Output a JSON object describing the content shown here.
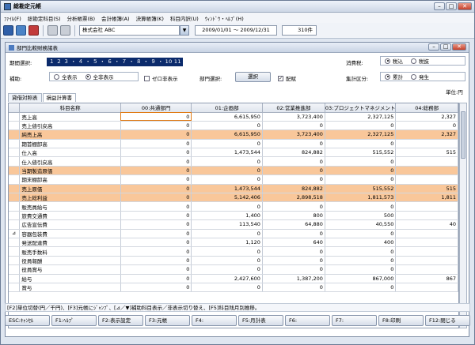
{
  "window": {
    "title": "部門比較財務諸表",
    "app_title": "総勘定元帳"
  },
  "menu": [
    "ﾌｧｲﾙ(F)",
    "総勘定科目(S)",
    "分析帳票(B)",
    "会計帳簿(A)",
    "決算帳簿(K)",
    "科目内訳(U)",
    "ｳｨﾝﾄﾞｳ・ﾍﾙﾌﾟ(H)"
  ],
  "toolbar": {
    "company": "株式会社 ABC",
    "period": "2009/01/01 〜 2009/12/31",
    "count": "310件"
  },
  "options": {
    "period_label": "期間選択:",
    "months": "１ ２ ３ ・ ４ ・ ５ ・ ６ ・ ７ ・ ８ ・ ９ ・ 10 11 12 決",
    "hojo_label": "補助:",
    "hojo_all": "全表示",
    "hojo_all_checked": "全非表示",
    "zero_hide": "ゼロ非表示",
    "dept_label": "部門選択:",
    "select_button": "選択",
    "haifu": "配賦",
    "tax_label": "消費税:",
    "tax_in": "税込",
    "tax_out": "税抜",
    "sum_label": "集計区分:",
    "sum_total": "累計",
    "sum_occur": "発生",
    "unit": "単位:円"
  },
  "tabs": [
    "貸借対照表",
    "損益計算書"
  ],
  "columns": [
    "科目名称",
    "00:共通部門",
    "01:企画部",
    "02:営業推進部",
    "03:プロジェクトマネジメント",
    "04:総務部"
  ],
  "rows": [
    {
      "mk": "",
      "name": "売上高",
      "hl": false,
      "v": [
        "0",
        "6,615,950",
        "3,723,400",
        "2,327,125",
        "2,327"
      ]
    },
    {
      "mk": "",
      "name": "売上値引戻高",
      "hl": false,
      "v": [
        "0",
        "0",
        "0",
        "0",
        "0"
      ]
    },
    {
      "mk": "",
      "name": "純売上高",
      "hl": true,
      "v": [
        "0",
        "6,615,950",
        "3,723,400",
        "2,327,125",
        "2,327"
      ]
    },
    {
      "mk": "",
      "name": "期首棚卸高",
      "hl": false,
      "v": [
        "0",
        "0",
        "0",
        "0",
        ""
      ]
    },
    {
      "mk": "",
      "name": "仕入高",
      "hl": false,
      "v": [
        "0",
        "1,473,544",
        "824,882",
        "515,552",
        "515"
      ]
    },
    {
      "mk": "",
      "name": "仕入値引戻高",
      "hl": false,
      "v": [
        "0",
        "0",
        "0",
        "0",
        ""
      ]
    },
    {
      "mk": "",
      "name": "当期製造原価",
      "hl": true,
      "v": [
        "0",
        "0",
        "0",
        "0",
        ""
      ]
    },
    {
      "mk": "",
      "name": "期末棚卸高",
      "hl": false,
      "v": [
        "0",
        "0",
        "0",
        "0",
        ""
      ]
    },
    {
      "mk": "",
      "name": "売上原価",
      "hl": true,
      "v": [
        "0",
        "1,473,544",
        "824,882",
        "515,552",
        "515"
      ]
    },
    {
      "mk": "",
      "name": "売上総利益",
      "hl": true,
      "v": [
        "0",
        "5,142,406",
        "2,898,518",
        "1,811,573",
        "1,811"
      ]
    },
    {
      "mk": "",
      "name": "販売員給与",
      "hl": false,
      "v": [
        "0",
        "0",
        "0",
        "0",
        ""
      ]
    },
    {
      "mk": "",
      "name": "旅費交通費",
      "hl": false,
      "v": [
        "0",
        "1,400",
        "800",
        "500",
        ""
      ]
    },
    {
      "mk": "",
      "name": "広告宣伝費",
      "hl": false,
      "v": [
        "0",
        "113,540",
        "64,880",
        "40,550",
        "40"
      ]
    },
    {
      "mk": "⊿",
      "name": "容器包装費",
      "hl": false,
      "v": [
        "0",
        "0",
        "0",
        "0",
        ""
      ]
    },
    {
      "mk": "",
      "name": "発送配達費",
      "hl": false,
      "v": [
        "0",
        "1,120",
        "640",
        "400",
        ""
      ]
    },
    {
      "mk": "",
      "name": "販売手数料",
      "hl": false,
      "v": [
        "0",
        "0",
        "0",
        "0",
        ""
      ]
    },
    {
      "mk": "",
      "name": "役員報酬",
      "hl": false,
      "v": [
        "0",
        "0",
        "0",
        "0",
        ""
      ]
    },
    {
      "mk": "",
      "name": "役員賞与",
      "hl": false,
      "v": [
        "0",
        "0",
        "0",
        "0",
        ""
      ]
    },
    {
      "mk": "",
      "name": "給与",
      "hl": false,
      "v": [
        "0",
        "2,427,600",
        "1,387,200",
        "867,000",
        "867"
      ]
    },
    {
      "mk": "",
      "name": "賞与",
      "hl": false,
      "v": [
        "0",
        "0",
        "0",
        "0",
        ""
      ]
    }
  ],
  "status_text": "[F2]単位切替(円／千円)、[F3]元帳にｼﾞｬﾝﾌﾟ、[⊿／▼]補助科目表示／非表示切り替え、[F5]科目残月別推移。",
  "fkeys": [
    "ESC:ｷｬﾝｾﾙ",
    "F1:ﾍﾙﾌﾟ",
    "F2:表示設定",
    "F3:元帳",
    "F4:",
    "F5:月計表",
    "F6:",
    "F7:",
    "F8:印刷",
    "F12:閉じる"
  ]
}
